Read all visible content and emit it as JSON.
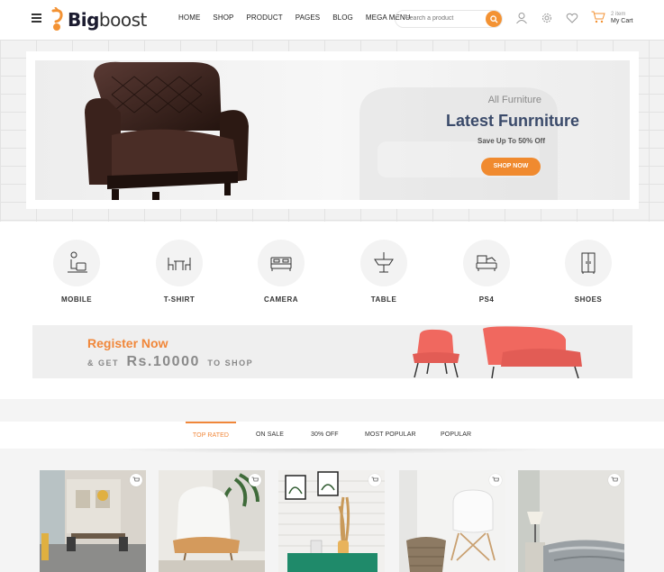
{
  "brand": {
    "name_bold": "Big",
    "name_regular": "boost"
  },
  "nav": [
    "HOME",
    "SHOP",
    "PRODUCT",
    "PAGES",
    "BLOG",
    "MEGA MENU"
  ],
  "search": {
    "placeholder": "Search a product",
    "value": ""
  },
  "cart": {
    "count": "2 item",
    "label": "My Cart"
  },
  "hero": {
    "kicker": "All Furniture",
    "title": "Latest Funrniture",
    "subtitle": "Save Up To 50% Off",
    "button": "SHOP NOW"
  },
  "categories": [
    {
      "label": "MOBILE",
      "icon": "person-chair-icon"
    },
    {
      "label": "T-SHIRT",
      "icon": "dining-table-icon"
    },
    {
      "label": "CAMERA",
      "icon": "bed-icon"
    },
    {
      "label": "TABLE",
      "icon": "chandelier-icon"
    },
    {
      "label": "PS4",
      "icon": "sofa-icon"
    },
    {
      "label": "SHOES",
      "icon": "wardrobe-icon"
    }
  ],
  "register": {
    "title": "Register Now",
    "prefix": "& GET",
    "amount": "Rs.10000",
    "suffix": "TO SHOP"
  },
  "tabs": [
    {
      "label": "TOP RATED",
      "active": true
    },
    {
      "label": "ON SALE",
      "active": false
    },
    {
      "label": "30% OFF",
      "active": false
    },
    {
      "label": "MOST POPULAR",
      "active": false
    },
    {
      "label": "POPULAR",
      "active": false
    }
  ],
  "colors": {
    "accent": "#f0873a",
    "heading": "#3a4a6a",
    "coral": "#f0685f"
  }
}
